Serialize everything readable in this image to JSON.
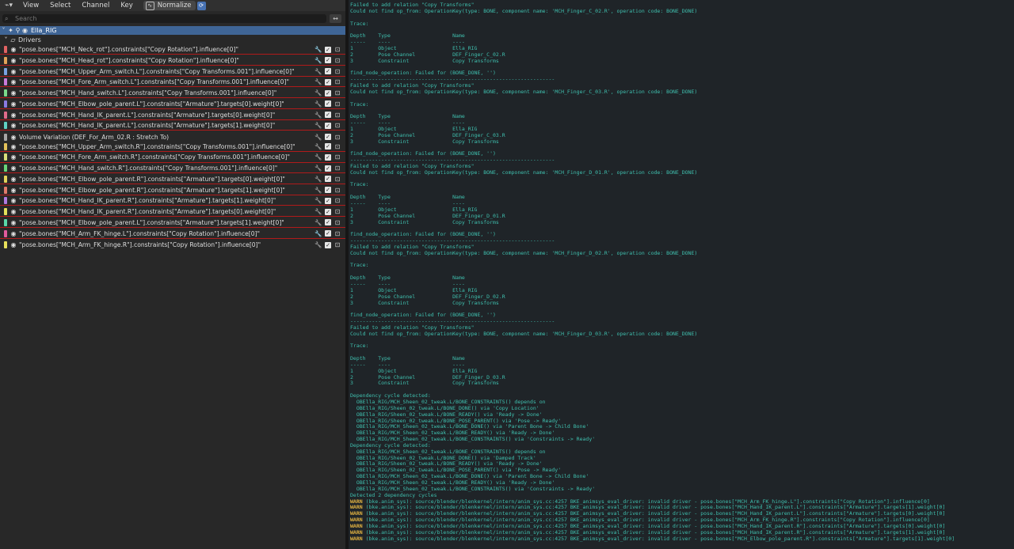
{
  "header": {
    "editor_icon": "graph-editor-icon",
    "menus": [
      "View",
      "Select",
      "Channel",
      "Key"
    ],
    "normalize_label": "Normalize"
  },
  "search": {
    "placeholder": "Search"
  },
  "object": {
    "name": "Ella_RIG"
  },
  "drivers_group": {
    "label": "Drivers"
  },
  "fcurves": [
    {
      "label": "\"pose.bones[\"MCH_Neck_rot\"].constraints[\"Copy Rotation\"].influence[0]\"",
      "color": "#e26363",
      "error": true,
      "wrench_active": true
    },
    {
      "label": "\"pose.bones[\"MCH_Head_rot\"].constraints[\"Copy Rotation\"].influence[0]\"",
      "color": "#e2a35a",
      "error": true,
      "wrench_active": true
    },
    {
      "label": "\"pose.bones[\"MCH_Upper_Arm_switch.L\"].constraints[\"Copy Transforms.001\"].influence[0]\"",
      "color": "#7aa1e0",
      "error": true,
      "wrench_active": false
    },
    {
      "label": "\"pose.bones[\"MCH_Fore_Arm_switch.L\"].constraints[\"Copy Transforms.001\"].influence[0]\"",
      "color": "#c87ad9",
      "error": true,
      "wrench_active": false
    },
    {
      "label": "\"pose.bones[\"MCH_Hand_switch.L\"].constraints[\"Copy Transforms.001\"].influence[0]\"",
      "color": "#7ad98b",
      "error": true,
      "wrench_active": false
    },
    {
      "label": "\"pose.bones[\"MCH_Elbow_pole_parent.L\"].constraints[\"Armature\"].targets[0].weight[0]\"",
      "color": "#8a7ae0",
      "error": true,
      "wrench_active": false
    },
    {
      "label": "\"pose.bones[\"MCH_Hand_IK_parent.L\"].constraints[\"Armature\"].targets[0].weight[0]\"",
      "color": "#e06b8b",
      "error": true,
      "wrench_active": false
    },
    {
      "label": "\"pose.bones[\"MCH_Hand_IK_parent.L\"].constraints[\"Armature\"].targets[1].weight[0]\"",
      "color": "#5fd3c4",
      "error": true,
      "wrench_active": false
    },
    {
      "label": "Volume Variation (DEF_For_Arm_02.R : Stretch To)",
      "color": "#a6a6a6",
      "error": false,
      "wrench_active": false
    },
    {
      "label": "\"pose.bones[\"MCH_Upper_Arm_switch.R\"].constraints[\"Copy Transforms.001\"].influence[0]\"",
      "color": "#e3c25a",
      "error": true,
      "wrench_active": false
    },
    {
      "label": "\"pose.bones[\"MCH_Fore_Arm_switch.R\"].constraints[\"Copy Transforms.001\"].influence[0]\"",
      "color": "#d9e07a",
      "error": true,
      "wrench_active": false
    },
    {
      "label": "\"pose.bones[\"MCH_Hand_switch.R\"].constraints[\"Copy Transforms.001\"].influence[0]\"",
      "color": "#6ad67a",
      "error": true,
      "wrench_active": false
    },
    {
      "label": "\"pose.bones[\"MCH_Elbow_pole_parent.R\"].constraints[\"Armature\"].targets[0].weight[0]\"",
      "color": "#e3d25a",
      "error": true,
      "wrench_active": false
    },
    {
      "label": "\"pose.bones[\"MCH_Elbow_pole_parent.R\"].constraints[\"Armature\"].targets[1].weight[0]\"",
      "color": "#e07a6b",
      "error": true,
      "wrench_active": false
    },
    {
      "label": "\"pose.bones[\"MCH_Hand_IK_parent.R\"].constraints[\"Armature\"].targets[1].weight[0]\"",
      "color": "#b07ae0",
      "error": true,
      "wrench_active": false
    },
    {
      "label": "\"pose.bones[\"MCH_Hand_IK_parent.R\"].constraints[\"Armature\"].targets[0].weight[0]\"",
      "color": "#e3e05a",
      "error": true,
      "wrench_active": false
    },
    {
      "label": "\"pose.bones[\"MCH_Elbow_pole_parent.L\"].constraints[\"Armature\"].targets[1].weight[0]\"",
      "color": "#5ad9a8",
      "error": true,
      "wrench_active": false
    },
    {
      "label": "\"pose.bones[\"MCH_Arm_FK_hinge.L\"].constraints[\"Copy Rotation\"].influence[0]\"",
      "color": "#e05a9c",
      "error": true,
      "wrench_active": true
    },
    {
      "label": "\"pose.bones[\"MCH_Arm_FK_hinge.R\"].constraints[\"Copy Rotation\"].influence[0]\"",
      "color": "#e8e05a",
      "error": false,
      "wrench_active": false
    }
  ],
  "console": [
    {
      "text": "Failed to add relation \"Copy Transforms\""
    },
    {
      "text": "Could not find op_from: OperationKey(type: BONE, component name: 'MCH_Finger_C_02.R', operation code: BONE_DONE)"
    },
    {
      "text": ""
    },
    {
      "text": "Trace:"
    },
    {
      "text": ""
    },
    {
      "text": "Depth    Type                    Name"
    },
    {
      "text": "-----    ----                    ----"
    },
    {
      "text": "1        Object                  Ella_RIG"
    },
    {
      "text": "2        Pose Channel            DEF_Finger_C_02.R"
    },
    {
      "text": "3        Constraint              Copy Transforms"
    },
    {
      "text": ""
    },
    {
      "text": "find_node_operation: Failed for (BONE_DONE, '')"
    },
    {
      "text": "------------------------------------------------------------------"
    },
    {
      "text": "Failed to add relation \"Copy Transforms\""
    },
    {
      "text": "Could not find op_from: OperationKey(type: BONE, component name: 'MCH_Finger_C_03.R', operation code: BONE_DONE)"
    },
    {
      "text": ""
    },
    {
      "text": "Trace:"
    },
    {
      "text": ""
    },
    {
      "text": "Depth    Type                    Name"
    },
    {
      "text": "-----    ----                    ----"
    },
    {
      "text": "1        Object                  Ella_RIG"
    },
    {
      "text": "2        Pose Channel            DEF_Finger_C_03.R"
    },
    {
      "text": "3        Constraint              Copy Transforms"
    },
    {
      "text": ""
    },
    {
      "text": "find_node_operation: Failed for (BONE_DONE, '')"
    },
    {
      "text": "------------------------------------------------------------------"
    },
    {
      "text": "Failed to add relation \"Copy Transforms\""
    },
    {
      "text": "Could not find op_from: OperationKey(type: BONE, component name: 'MCH_Finger_D_01.R', operation code: BONE_DONE)"
    },
    {
      "text": ""
    },
    {
      "text": "Trace:"
    },
    {
      "text": ""
    },
    {
      "text": "Depth    Type                    Name"
    },
    {
      "text": "-----    ----                    ----"
    },
    {
      "text": "1        Object                  Ella_RIG"
    },
    {
      "text": "2        Pose Channel            DEF_Finger_D_01.R"
    },
    {
      "text": "3        Constraint              Copy Transforms"
    },
    {
      "text": ""
    },
    {
      "text": "find_node_operation: Failed for (BONE_DONE, '')"
    },
    {
      "text": "------------------------------------------------------------------"
    },
    {
      "text": "Failed to add relation \"Copy Transforms\""
    },
    {
      "text": "Could not find op_from: OperationKey(type: BONE, component name: 'MCH_Finger_D_02.R', operation code: BONE_DONE)"
    },
    {
      "text": ""
    },
    {
      "text": "Trace:"
    },
    {
      "text": ""
    },
    {
      "text": "Depth    Type                    Name"
    },
    {
      "text": "-----    ----                    ----"
    },
    {
      "text": "1        Object                  Ella_RIG"
    },
    {
      "text": "2        Pose Channel            DEF_Finger_D_02.R"
    },
    {
      "text": "3        Constraint              Copy Transforms"
    },
    {
      "text": ""
    },
    {
      "text": "find_node_operation: Failed for (BONE_DONE, '')"
    },
    {
      "text": "------------------------------------------------------------------"
    },
    {
      "text": "Failed to add relation \"Copy Transforms\""
    },
    {
      "text": "Could not find op_from: OperationKey(type: BONE, component name: 'MCH_Finger_D_03.R', operation code: BONE_DONE)"
    },
    {
      "text": ""
    },
    {
      "text": "Trace:"
    },
    {
      "text": ""
    },
    {
      "text": "Depth    Type                    Name"
    },
    {
      "text": "-----    ----                    ----"
    },
    {
      "text": "1        Object                  Ella_RIG"
    },
    {
      "text": "2        Pose Channel            DEF_Finger_D_03.R"
    },
    {
      "text": "3        Constraint              Copy Transforms"
    },
    {
      "text": ""
    },
    {
      "text": "Dependency cycle detected:"
    },
    {
      "text": "  OBElla_RIG/MCH_Sheen_02_tweak.L/BONE_CONSTRAINTS() depends on"
    },
    {
      "text": "  OBElla_RIG/Sheen_02_tweak.L/BONE_DONE() via 'Copy Location'"
    },
    {
      "text": "  OBElla_RIG/Sheen_02_tweak.L/BONE_READY() via 'Ready -> Done'"
    },
    {
      "text": "  OBElla_RIG/Sheen_02_tweak.L/BONE_POSE_PARENT() via 'Pose -> Ready'"
    },
    {
      "text": "  OBElla_RIG/MCH_Sheen_02_tweak.L/BONE_DONE() via 'Parent Bone -> Child Bone'"
    },
    {
      "text": "  OBElla_RIG/MCH_Sheen_02_tweak.L/BONE_READY() via 'Ready -> Done'"
    },
    {
      "text": "  OBElla_RIG/MCH_Sheen_02_tweak.L/BONE_CONSTRAINTS() via 'Constraints -> Ready'"
    },
    {
      "text": "Dependency cycle detected:"
    },
    {
      "text": "  OBElla_RIG/MCH_Sheen_02_tweak.L/BONE_CONSTRAINTS() depends on"
    },
    {
      "text": "  OBElla_RIG/Sheen_02_tweak.L/BONE_DONE() via 'Damped Track'"
    },
    {
      "text": "  OBElla_RIG/Sheen_02_tweak.L/BONE_READY() via 'Ready -> Done'"
    },
    {
      "text": "  OBElla_RIG/Sheen_02_tweak.L/BONE_POSE_PARENT() via 'Pose -> Ready'"
    },
    {
      "text": "  OBElla_RIG/MCH_Sheen_02_tweak.L/BONE_DONE() via 'Parent Bone -> Child Bone'"
    },
    {
      "text": "  OBElla_RIG/MCH_Sheen_02_tweak.L/BONE_READY() via 'Ready -> Done'"
    },
    {
      "text": "  OBElla_RIG/MCH_Sheen_02_tweak.L/BONE_CONSTRAINTS() via 'Constraints -> Ready'"
    },
    {
      "text": "Detected 2 dependency cycles"
    },
    {
      "tag": "WARN",
      "text": " (bke.anim_sys): source/blender/blenkernel/intern/anim_sys.cc:4257 BKE_animsys_eval_driver: invalid driver - pose.bones[\"MCH_Arm_FK_hinge.L\"].constraints[\"Copy Rotation\"].influence[0]"
    },
    {
      "tag": "WARN",
      "text": " (bke.anim_sys): source/blender/blenkernel/intern/anim_sys.cc:4257 BKE_animsys_eval_driver: invalid driver - pose.bones[\"MCH_Hand_IK_parent.L\"].constraints[\"Armature\"].targets[1].weight[0]"
    },
    {
      "tag": "WARN",
      "text": " (bke.anim_sys): source/blender/blenkernel/intern/anim_sys.cc:4257 BKE_animsys_eval_driver: invalid driver - pose.bones[\"MCH_Hand_IK_parent.L\"].constraints[\"Armature\"].targets[0].weight[0]"
    },
    {
      "tag": "WARN",
      "text": " (bke.anim_sys): source/blender/blenkernel/intern/anim_sys.cc:4257 BKE_animsys_eval_driver: invalid driver - pose.bones[\"MCH_Arm_FK_hinge.R\"].constraints[\"Copy Rotation\"].influence[0]"
    },
    {
      "tag": "WARN",
      "text": " (bke.anim_sys): source/blender/blenkernel/intern/anim_sys.cc:4257 BKE_animsys_eval_driver: invalid driver - pose.bones[\"MCH_Hand_IK_parent.R\"].constraints[\"Armature\"].targets[0].weight[0]"
    },
    {
      "tag": "WARN",
      "text": " (bke.anim_sys): source/blender/blenkernel/intern/anim_sys.cc:4257 BKE_animsys_eval_driver: invalid driver - pose.bones[\"MCH_Hand_IK_parent.R\"].constraints[\"Armature\"].targets[1].weight[0]"
    },
    {
      "tag": "WARN",
      "text": " (bke.anim_sys): source/blender/blenkernel/intern/anim_sys.cc:4257 BKE_animsys_eval_driver: invalid driver - pose.bones[\"MCH_Elbow_pole_parent.R\"].constraints[\"Armature\"].targets[1].weight[0]"
    }
  ]
}
